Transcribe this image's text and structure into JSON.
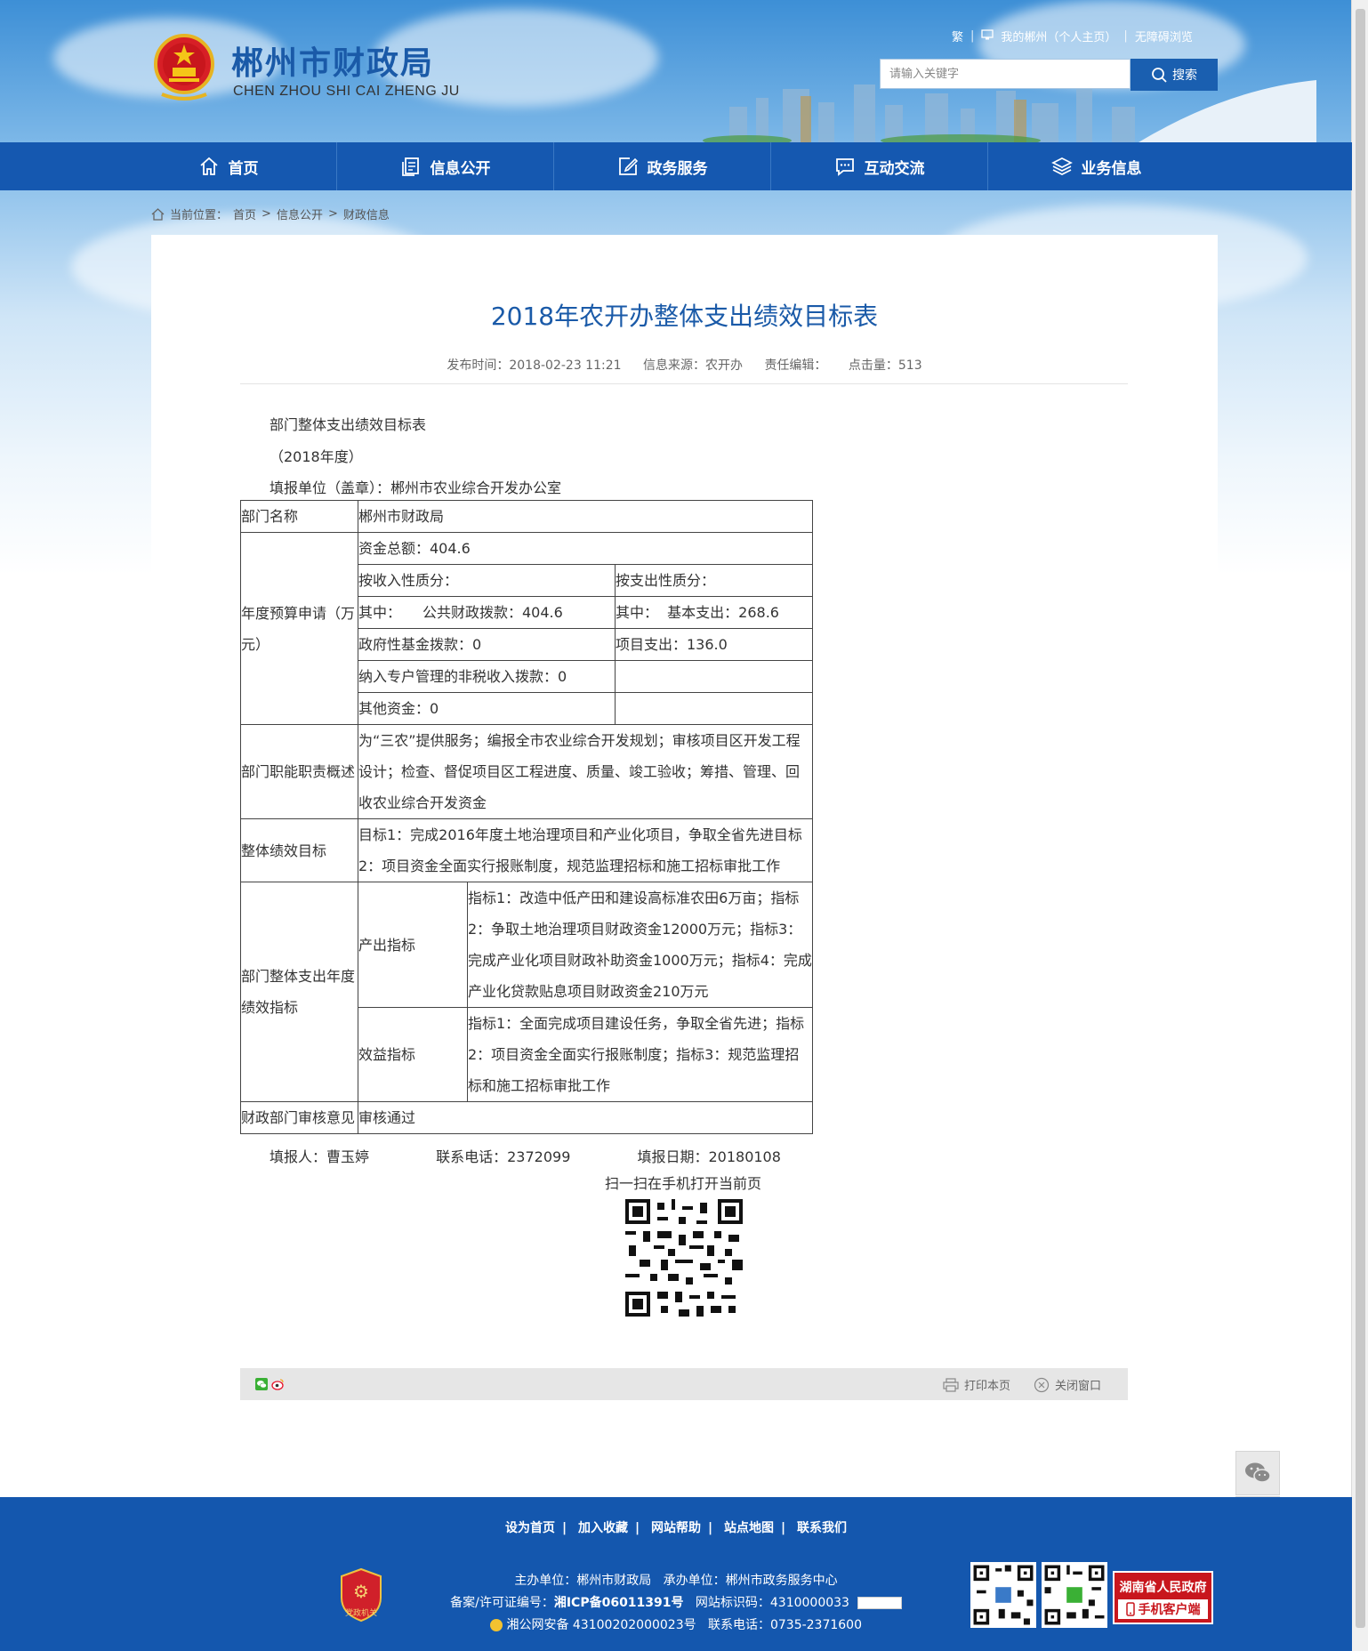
{
  "header": {
    "site_title": "郴州市财政局",
    "site_subtitle": "CHEN ZHOU SHI CAI ZHENG JU",
    "top_links": [
      "繁",
      "我的郴州（个人主页）",
      "无障碍浏览"
    ],
    "search_placeholder": "请输入关键字",
    "search_button": "搜索"
  },
  "nav": {
    "items": [
      {
        "label": "首页",
        "icon": "home-icon"
      },
      {
        "label": "信息公开",
        "icon": "document-icon"
      },
      {
        "label": "政务服务",
        "icon": "edit-icon"
      },
      {
        "label": "互动交流",
        "icon": "chat-icon"
      },
      {
        "label": "业务信息",
        "icon": "layers-icon"
      }
    ]
  },
  "breadcrumb": {
    "prefix": "当前位置：",
    "items": [
      "首页",
      "信息公开",
      "财政信息"
    ],
    "separator": ">"
  },
  "article": {
    "title": "2018年农开办整体支出绩效目标表",
    "publish_time": "发布时间：2018-02-23 11:21",
    "source": "信息来源：农开办",
    "editor": "责任编辑：",
    "clicks": "点击量：513",
    "heading1": "部门整体支出绩效目标表",
    "heading2": "（2018年度）",
    "heading3": "填报单位（盖章）：郴州市农业综合开发办公室"
  },
  "table": {
    "dept_name_label": "部门名称",
    "dept_name_value": "郴州市财政局",
    "budget_label": "年度预算申请（万元）",
    "total_funds": "资金总额：404.6",
    "by_income": "按收入性质分：",
    "by_expense": "按支出性质分：",
    "income_1": "其中：　　公共财政拨款：404.6",
    "expense_1": "其中：  基本支出：268.6",
    "income_2": "政府性基金拨款：0",
    "expense_2": "项目支出：136.0",
    "income_3": "纳入专户管理的非税收入拨款：0",
    "income_4": "其他资金：0",
    "duty_label": "部门职能职责概述",
    "duty_value": "为“三农”提供服务；编报全市农业综合开发规划；审核项目区开发工程设计；检查、督促项目区工程进度、质量、竣工验收；筹措、管理、回收农业综合开发资金",
    "goal_label": "整体绩效目标",
    "goal_value": "目标1：完成2016年度土地治理项目和产业化项目，争取全省先进目标2：项目资金全面实行报账制度，规范监理招标和施工招标审批工作",
    "indicator_label": "部门整体支出年度绩效指标",
    "output_label": "产出指标",
    "output_value": "指标1：改造中低产田和建设高标准农田6万亩；指标2：争取土地治理项目财政资金12000万元；指标3：完成产业化项目财政补助资金1000万元；指标4：完成产业化贷款贴息项目财政资金210万元",
    "benefit_label": "效益指标",
    "benefit_value": "指标1：全面完成项目建设任务，争取全省先进；指标2：项目资金全面实行报账制度；指标3：规范监理招标和施工招标审批工作",
    "review_label": "财政部门审核意见",
    "review_value": "审核通过"
  },
  "signoff": {
    "filler": "填报人：曹玉婷",
    "phone": "联系电话：2372099",
    "date": "填报日期：20180108"
  },
  "qr": {
    "label": "扫一扫在手机打开当前页"
  },
  "sharebar": {
    "print": "打印本页",
    "close": "关闭窗口"
  },
  "footer": {
    "links": [
      "设为首页",
      "加入收藏",
      "网站帮助",
      "站点地图",
      "联系我们"
    ],
    "host": "主办单位：郴州市财政局",
    "undertaker": "承办单位：郴州市政务服务中心",
    "icp_prefix": "备案/许可证编号：",
    "icp": "湘ICP备06011391号",
    "site_code": "网站标识码：4310000033",
    "police": "湘公网安备 43100202000023号",
    "contact": "联系电话：0735-2371600",
    "gov_badge_line1": "湖南省人民政府",
    "gov_badge_line2": "手机客户端",
    "party_badge": "党政机关"
  },
  "colors": {
    "brand_blue": "#1558b0",
    "title_blue": "#1a5aa8",
    "footer_blue": "#1457ae",
    "badge_red": "#c8161d"
  }
}
